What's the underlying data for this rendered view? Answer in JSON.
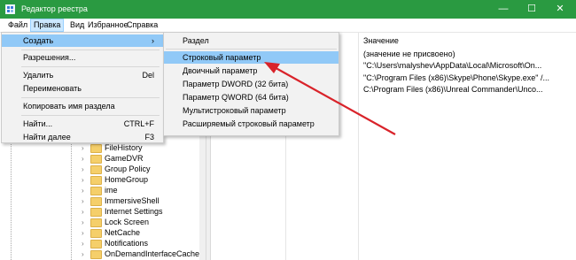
{
  "window": {
    "title": "Редактор реестра",
    "minimize": "—",
    "maximize": "☐",
    "close": "✕"
  },
  "menubar": [
    "Файл",
    "Правка",
    "Вид",
    "Избранное",
    "Справка"
  ],
  "edit_menu": [
    {
      "label": "Создать",
      "shortcut": "›"
    },
    {
      "label": "Разрешения...",
      "shortcut": ""
    },
    {
      "label": "Удалить",
      "shortcut": "Del"
    },
    {
      "label": "Переименовать",
      "shortcut": ""
    },
    {
      "label": "Копировать имя раздела",
      "shortcut": ""
    },
    {
      "label": "Найти...",
      "shortcut": "CTRL+F"
    },
    {
      "label": "Найти далее",
      "shortcut": "F3"
    }
  ],
  "create_submenu": [
    "Раздел",
    "Строковый параметр",
    "Двоичный параметр",
    "Параметр DWORD (32 бита)",
    "Параметр QWORD (64 бита)",
    "Мультистроковый параметр",
    "Расширяемый строковый параметр"
  ],
  "values_pane": {
    "header": "Значение",
    "rows": [
      "(значение не присвоено)",
      "\"C:\\Users\\malyshev\\AppData\\Local\\Microsoft\\On...",
      "\"C:\\Program Files (x86)\\Skype\\Phone\\Skype.exe\" /...",
      "C:\\Program Files (x86)\\Unreal Commander\\Unco..."
    ]
  },
  "tree": [
    "FileHistory",
    "GameDVR",
    "Group Policy",
    "HomeGroup",
    "ime",
    "ImmersiveShell",
    "Internet Settings",
    "Lock Screen",
    "NetCache",
    "Notifications",
    "OnDemandInterfaceCache"
  ],
  "colors": {
    "titlebar": "#2a9a41",
    "highlight": "#91c9f7",
    "arrow": "#d9232a"
  }
}
